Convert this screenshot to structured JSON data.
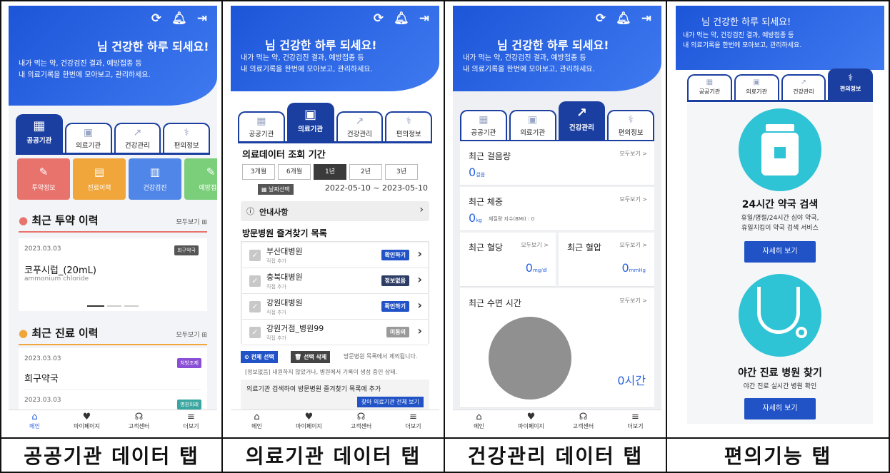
{
  "captions": [
    "공공기관 데이터 탭",
    "의료기관 데이터 탭",
    "건강관리 데이터 탭",
    "편의기능 탭"
  ],
  "common": {
    "greeting": "님 건강한 하루 되세요!",
    "subtitle_line1": "내가 먹는 약, 건강검진 결과, 예방접종 등",
    "subtitle_line2": "내 의료기록을 한번에 모아보고, 관리하세요.",
    "refresh_icon": "refresh-icon",
    "bell_icon": "bell-icon",
    "logout_icon": "logout-icon",
    "tabs": [
      "공공기관",
      "의료기관",
      "건강관리",
      "편의정보"
    ],
    "bottom_nav": [
      "메인",
      "마이페이지",
      "고객센터",
      "더보기"
    ]
  },
  "screen1": {
    "tiles": [
      "투약정보",
      "진료이력",
      "건강검진",
      "예방접종"
    ],
    "tile_colors": [
      "#e8736c",
      "#f0a63a",
      "#4f86e8",
      "#7bcf7a"
    ],
    "med_title": "최근 투약 이력",
    "med_more": "모두보기",
    "med_date": "2023.03.03",
    "med_badge": "희구약국",
    "med_name": "코푸시럽_(20mL)",
    "med_ingredient": "ammonium chloride",
    "visit_title": "최근 진료 이력",
    "visit_more": "모두보기",
    "visit1_date": "2023.03.03",
    "visit1_badge": "처방조제",
    "visit1_name": "희구약국",
    "visit2_date": "2023.03.03",
    "visit2_badge": "병원외래"
  },
  "screen2": {
    "period_title": "의료데이터 조회 기간",
    "periods": [
      "3개월",
      "6개월",
      "1년",
      "2년",
      "3년"
    ],
    "selected_period": "1년",
    "date_btn": "날짜선택",
    "date_range": "2022-05-10 ~ 2023-05-10",
    "notice": "안내사항",
    "fav_title": "방문병원 즐겨찾기 목록",
    "hospitals": [
      {
        "name": "부산대병원",
        "sub": "직접 추가",
        "btn": "확인하기",
        "color": "#2153c7"
      },
      {
        "name": "충북대병원",
        "sub": "직접 추가",
        "btn": "정보없음",
        "color": "#2d3d66"
      },
      {
        "name": "강원대병원",
        "sub": "직접 추가",
        "btn": "확인하기",
        "color": "#2153c7"
      },
      {
        "name": "강원거점_병원99",
        "sub": "직접 추가",
        "btn": "미동의",
        "color": "#9a9a9a"
      }
    ],
    "select_all": "전체 선택",
    "delete_sel": "선택 삭제",
    "remove_note": "방문병원 목록에서 제외됩니다.",
    "info_note": "[정보없음] 내원하지 않았거나, 병원에서 기록이 생성 중인 상태.",
    "search_note": "의료기관 검색하여 방문병원 즐겨찾기 목록에 추가",
    "view_all_btn": "찾아 의료기관 전체 보기"
  },
  "screen3": {
    "steps_title": "최근 걸음량",
    "steps_more": "모두보기 >",
    "steps_val": "0",
    "steps_unit": "걸음",
    "weight_title": "최근 체중",
    "weight_more": "모두보기 >",
    "weight_val": "0",
    "weight_unit": "kg",
    "bmi": "체질량 지수(BMI) : 0",
    "sugar_title": "최근 혈당",
    "sugar_more": "모두보기 >",
    "sugar_val": "0",
    "sugar_unit": "mg/dl",
    "bp_title": "최근 혈압",
    "bp_more": "모두보기 >",
    "bp_val": "0",
    "bp_unit": "mmHg",
    "sleep_title": "최근 수면 시간",
    "sleep_more": "모두보기 >",
    "sleep_val": "0시간"
  },
  "screen4": {
    "pharmacy_title": "24시간 약국 검색",
    "pharmacy_desc1": "휴일/명절/24시간 심야 약국,",
    "pharmacy_desc2": "휴일지킴이 약국 검색 서비스",
    "detail_btn": "자세히 보기",
    "night_title": "야간 진료 병원 찾기",
    "night_desc": "야간 진료 실시간 병원 확인",
    "detail_btn2": "자세히 보기"
  }
}
